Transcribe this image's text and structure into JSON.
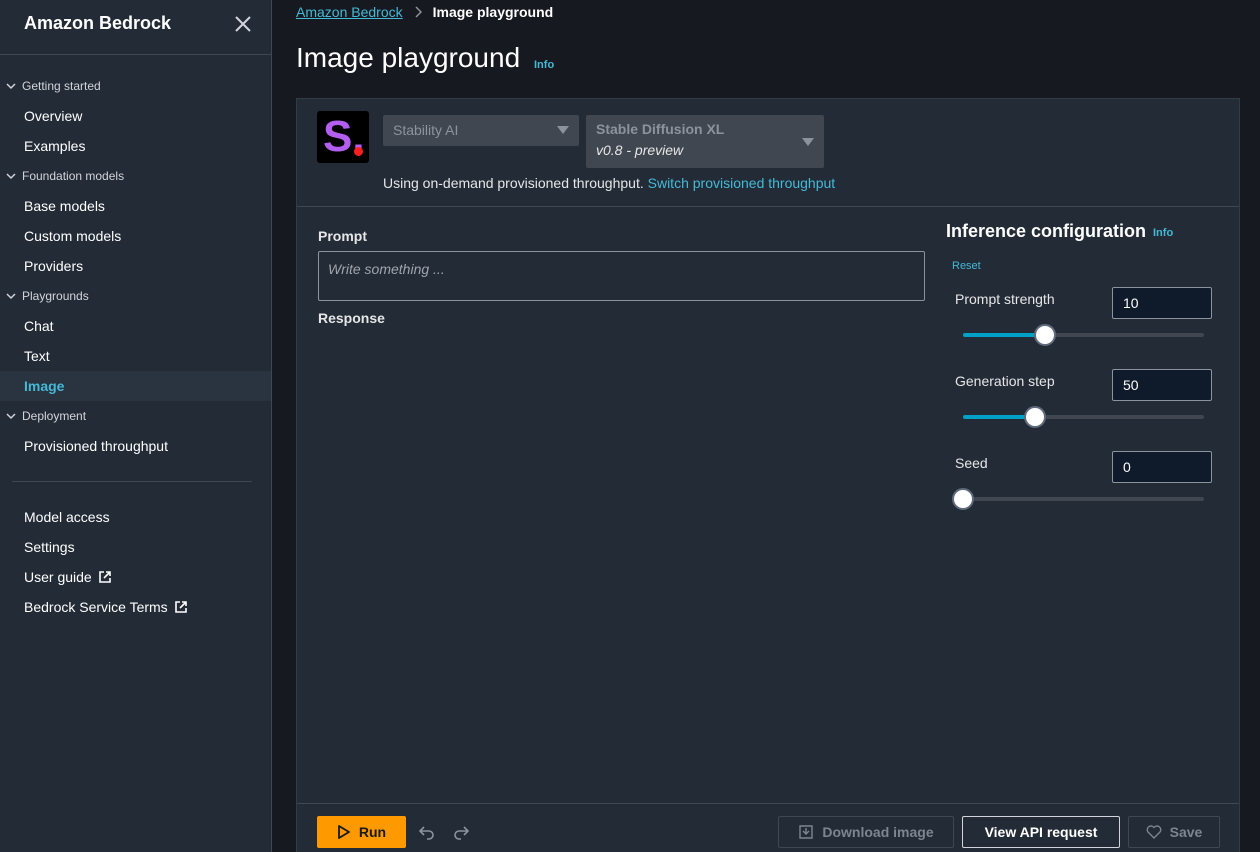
{
  "sidebar": {
    "title": "Amazon Bedrock",
    "sections": {
      "getting_started": "Getting started",
      "foundation_models": "Foundation models",
      "playgrounds": "Playgrounds",
      "deployment": "Deployment"
    },
    "items": {
      "overview": "Overview",
      "examples": "Examples",
      "base_models": "Base models",
      "custom_models": "Custom models",
      "providers": "Providers",
      "chat": "Chat",
      "text": "Text",
      "image": "Image",
      "provisioned_throughput": "Provisioned throughput",
      "model_access": "Model access",
      "settings": "Settings",
      "user_guide": "User guide",
      "service_terms": "Bedrock Service Terms"
    },
    "active_item": "Image"
  },
  "breadcrumb": {
    "parent": "Amazon Bedrock",
    "current": "Image playground"
  },
  "page": {
    "title": "Image playground",
    "info": "Info"
  },
  "model": {
    "provider": "Stability AI",
    "name": "Stable Diffusion XL",
    "version": "v0.8 - preview",
    "logo_letter": "S.",
    "throughput_text": "Using on-demand provisioned throughput.",
    "throughput_link": "Switch provisioned throughput"
  },
  "prompt": {
    "label": "Prompt",
    "placeholder": "Write something ...",
    "response_label": "Response"
  },
  "inference": {
    "title": "Inference configuration",
    "info": "Info",
    "reset": "Reset",
    "params": {
      "prompt_strength": {
        "label": "Prompt strength",
        "value": "10",
        "fraction": 0.34
      },
      "generation_step": {
        "label": "Generation step",
        "value": "50",
        "fraction": 0.3
      },
      "seed": {
        "label": "Seed",
        "value": "0",
        "fraction": 0.0
      }
    }
  },
  "footer": {
    "run": "Run",
    "download": "Download image",
    "view_api": "View API request",
    "save": "Save"
  },
  "colors": {
    "accent": "#44b9d6",
    "run_button": "#ff9900",
    "slider_fill": "#00a1c9",
    "background": "#16191f",
    "panel": "#232b37"
  }
}
